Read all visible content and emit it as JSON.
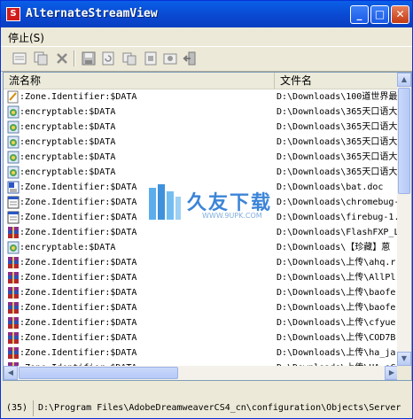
{
  "window": {
    "title": "AlternateStreamView",
    "app_icon_letter": "S",
    "buttons": {
      "minimize": "_",
      "maximize": "□",
      "close": "✕"
    }
  },
  "menu": {
    "items": [
      {
        "label": "停止(S)"
      }
    ]
  },
  "toolbar": {
    "icons": [
      "properties-icon",
      "copy-icon",
      "delete-icon",
      "save-icon",
      "refresh-icon",
      "copy-table-icon",
      "html-report-icon",
      "about-icon",
      "exit-icon"
    ]
  },
  "list": {
    "columns": {
      "stream_name": "流名称",
      "file_name": "文件名"
    },
    "rows": [
      {
        "icon": "text-icon",
        "stream": ":Zone.Identifier:$DATA",
        "file": "D:\\Downloads\\100道世界最"
      },
      {
        "icon": "app-icon",
        "stream": ":encryptable:$DATA",
        "file": "D:\\Downloads\\365天口语大"
      },
      {
        "icon": "app-icon",
        "stream": ":encryptable:$DATA",
        "file": "D:\\Downloads\\365天口语大"
      },
      {
        "icon": "app-icon",
        "stream": ":encryptable:$DATA",
        "file": "D:\\Downloads\\365天口语大"
      },
      {
        "icon": "app-icon",
        "stream": ":encryptable:$DATA",
        "file": "D:\\Downloads\\365天口语大"
      },
      {
        "icon": "app-icon",
        "stream": ":encryptable:$DATA",
        "file": "D:\\Downloads\\365天口语大"
      },
      {
        "icon": "doc-icon",
        "stream": ":Zone.Identifier:$DATA",
        "file": "D:\\Downloads\\bat.doc"
      },
      {
        "icon": "window-icon",
        "stream": ":Zone.Identifier:$DATA",
        "file": "D:\\Downloads\\chromebug-"
      },
      {
        "icon": "window-icon",
        "stream": ":Zone.Identifier:$DATA",
        "file": "D:\\Downloads\\firebug-1."
      },
      {
        "icon": "archive-icon",
        "stream": ":Zone.Identifier:$DATA",
        "file": "D:\\Downloads\\FlashFXP_L"
      },
      {
        "icon": "app-icon",
        "stream": ":encryptable:$DATA",
        "file": "D:\\Downloads\\【珍藏】蒽"
      },
      {
        "icon": "archive-icon",
        "stream": ":Zone.Identifier:$DATA",
        "file": "D:\\Downloads\\上传\\ahq.r"
      },
      {
        "icon": "archive-icon",
        "stream": ":Zone.Identifier:$DATA",
        "file": "D:\\Downloads\\上传\\AllPl"
      },
      {
        "icon": "archive-icon",
        "stream": ":Zone.Identifier:$DATA",
        "file": "D:\\Downloads\\上传\\baofe"
      },
      {
        "icon": "archive-icon",
        "stream": ":Zone.Identifier:$DATA",
        "file": "D:\\Downloads\\上传\\baofe"
      },
      {
        "icon": "archive-icon",
        "stream": ":Zone.Identifier:$DATA",
        "file": "D:\\Downloads\\上传\\cfyue"
      },
      {
        "icon": "archive-icon",
        "stream": ":Zone.Identifier:$DATA",
        "file": "D:\\Downloads\\上传\\COD7B"
      },
      {
        "icon": "archive-icon",
        "stream": ":Zone.Identifier:$DATA",
        "file": "D:\\Downloads\\上传\\ha_ja"
      },
      {
        "icon": "archive-icon",
        "stream": ":Zone.Identifier:$DATA",
        "file": "D:\\Downloads\\上传\\HA_oC"
      }
    ]
  },
  "status": {
    "count": "(35)",
    "path": "D:\\Program Files\\AdobeDreamweaverCS4_cn\\configuration\\Objects\\Server"
  },
  "watermark": {
    "text": "久友下载",
    "sub": "WWW.9UPK.COM"
  }
}
